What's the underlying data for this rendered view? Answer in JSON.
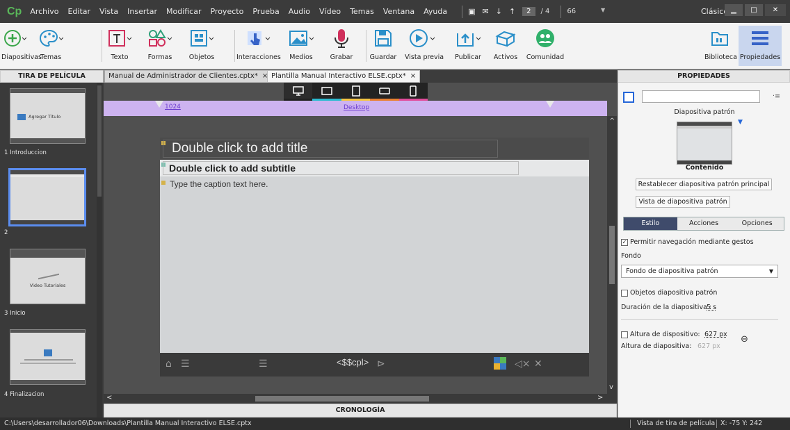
{
  "app": {
    "logo": "Cp"
  },
  "menu": [
    "Archivo",
    "Editar",
    "Vista",
    "Insertar",
    "Modificar",
    "Proyecto",
    "Prueba",
    "Audio",
    "Vídeo",
    "Temas",
    "Ventana",
    "Ayuda"
  ],
  "menubar": {
    "slide_current": "2",
    "slide_total": "/ 4",
    "zoom": "66",
    "mode": "Clásico"
  },
  "toolbar": {
    "diapositivas": "Diapositivas",
    "temas": "Temas",
    "texto": "Texto",
    "formas": "Formas",
    "objetos": "Objetos",
    "interacciones": "Interacciones",
    "medios": "Medios",
    "grabar": "Grabar",
    "guardar": "Guardar",
    "vista_previa": "Vista previa",
    "publicar": "Publicar",
    "activos": "Activos",
    "comunidad": "Comunidad",
    "biblioteca": "Biblioteca",
    "propiedades": "Propiedades"
  },
  "panels": {
    "filmstrip": "TIRA DE PELÍCULA",
    "properties": "PROPIEDADES",
    "timeline": "CRONOLOGÍA"
  },
  "tabs": [
    {
      "label": "Manual de Administrador de Clientes.cptx*",
      "close": "×"
    },
    {
      "label": "Plantilla Manual Interactivo ELSE.cptx*",
      "close": "×"
    }
  ],
  "slides": [
    {
      "label": "1 Introduccion",
      "thumb_title": "Agregar Título"
    },
    {
      "label": "2"
    },
    {
      "label": "3 Inicio",
      "thumb_title": "Video Tutoriales"
    },
    {
      "label": "4 Finalizacion"
    }
  ],
  "stage": {
    "bp_size": "1024",
    "bp_name": "Desktop",
    "title_placeholder": "Double click to add title",
    "subtitle_placeholder": "Double click to add subtitle",
    "caption_placeholder": "Type the caption text here.",
    "playbar_text": "<$$cpl>"
  },
  "properties": {
    "master_title": "Diapositiva patrón",
    "content_label": "Contenido",
    "reset_btn": "Restablecer diapositiva patrón principal",
    "view_btn": "Vista de diapositiva patrón",
    "tabs": [
      "Estilo",
      "Acciones",
      "Opciones"
    ],
    "gestures": "Permitir navegación mediante gestos",
    "fondo_label": "Fondo",
    "fondo_value": "Fondo de diapositiva patrón",
    "master_objects": "Objetos diapositiva patrón",
    "duration_label": "Duración de la diapositiva :",
    "duration_value": "5 s",
    "device_height_label": "Altura de dispositivo:",
    "device_height_value": "627 px",
    "slide_height_label": "Altura de diapositiva:",
    "slide_height_value": "627 px"
  },
  "status": {
    "path": "C:\\Users\\desarrollador06\\Downloads\\Plantilla Manual Interactivo ELSE.cptx",
    "view": "Vista de tira de película",
    "coords": "X: -75 Y: 242"
  }
}
